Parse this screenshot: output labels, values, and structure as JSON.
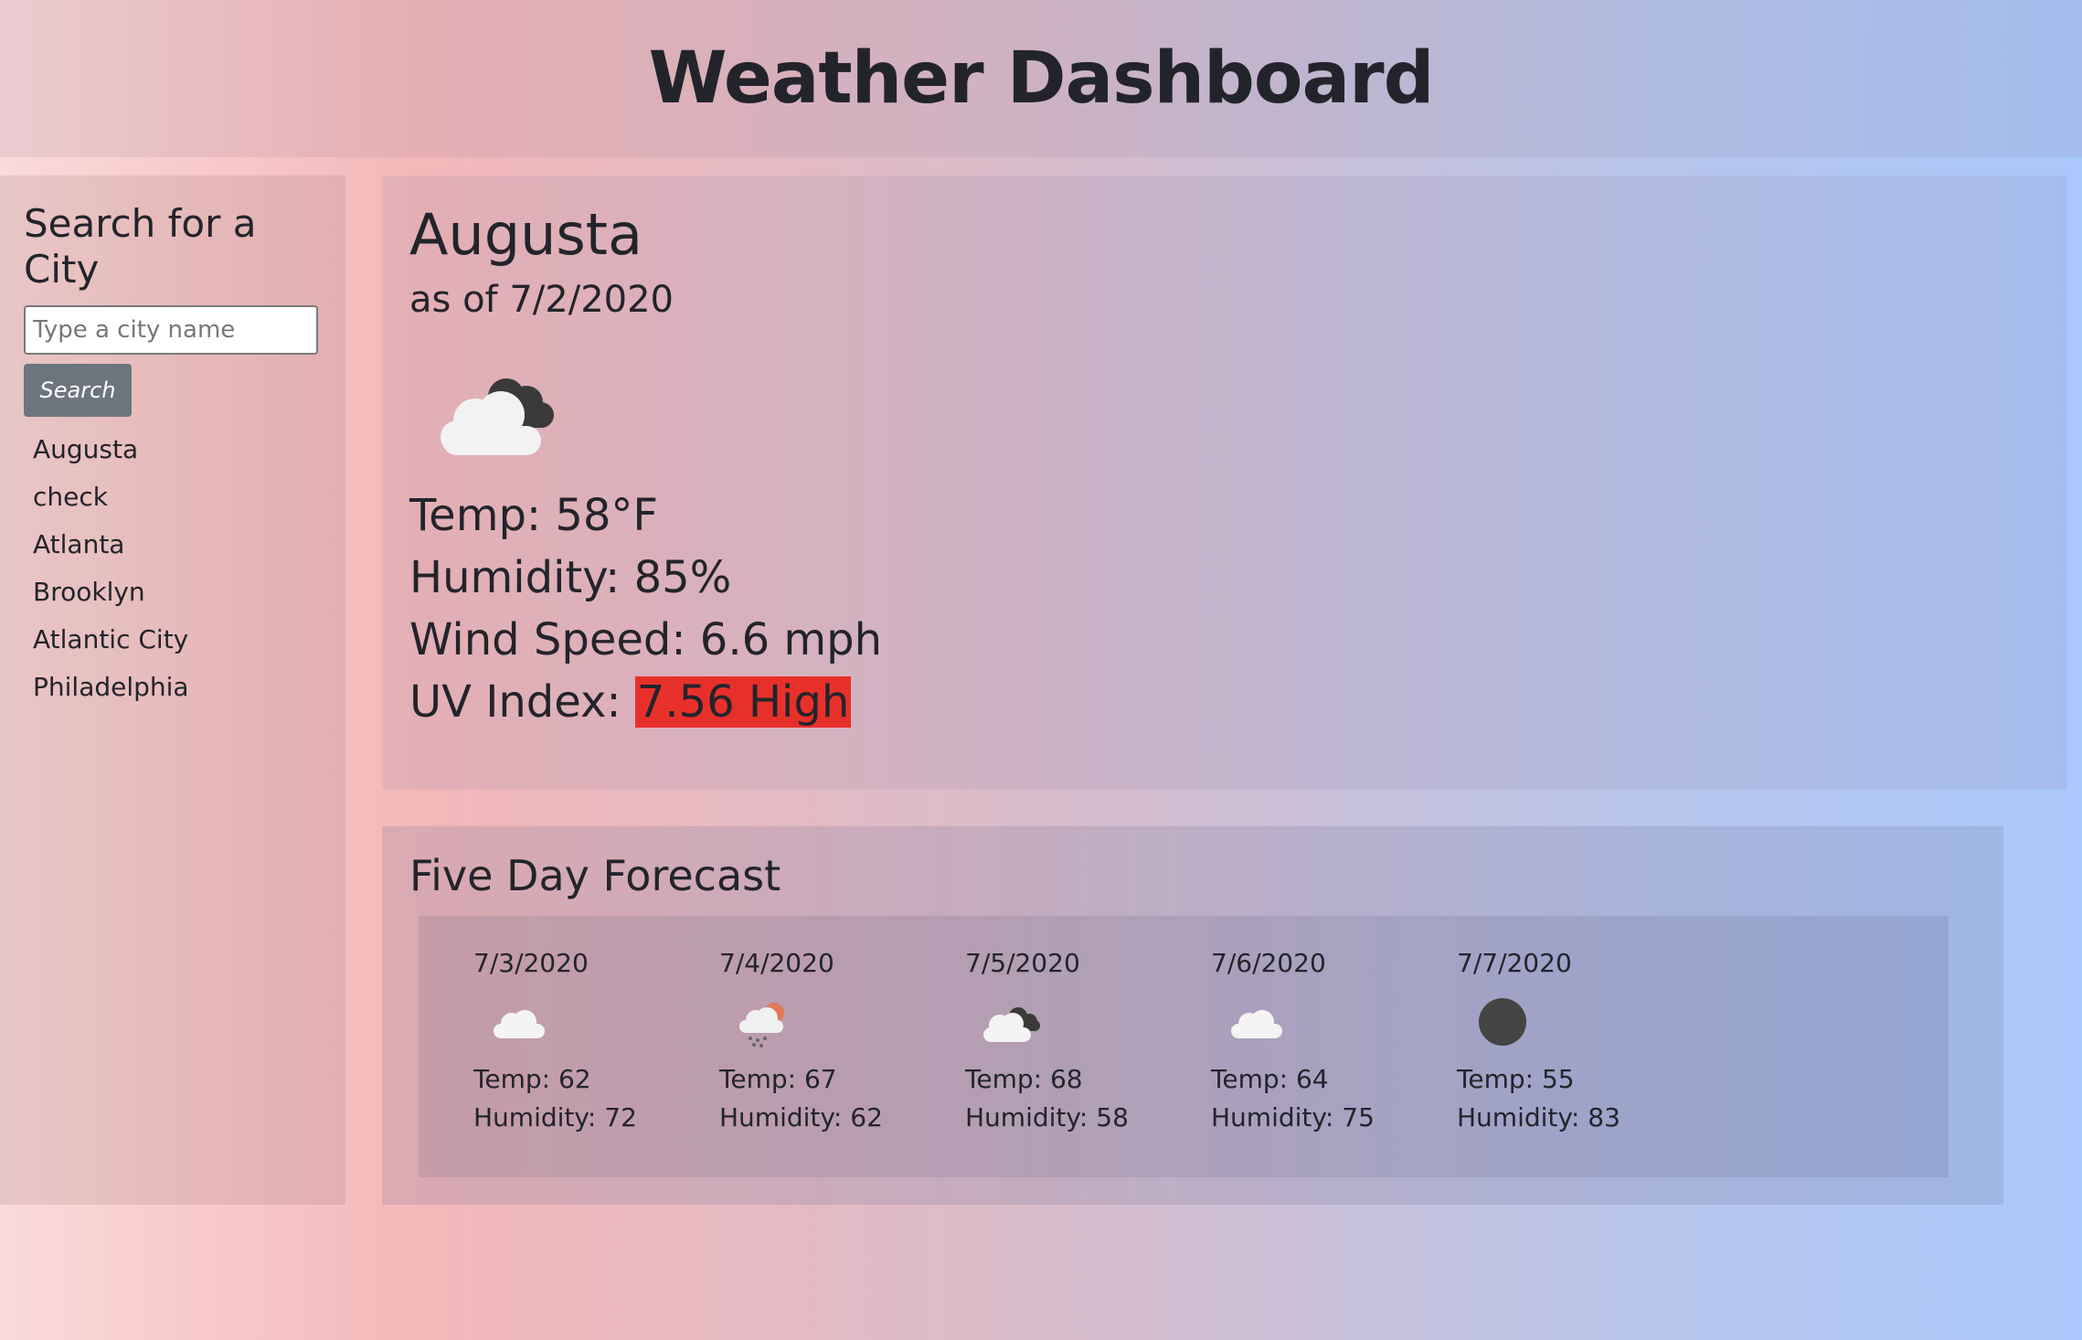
{
  "header": {
    "title": "Weather Dashboard"
  },
  "sidebar": {
    "heading": "Search for a City",
    "search": {
      "placeholder": "Type a city name",
      "value": ""
    },
    "search_button_label": "Search",
    "history": [
      "Augusta",
      "check",
      "Atlanta",
      "Brooklyn",
      "Atlantic City",
      "Philadelphia"
    ]
  },
  "current": {
    "city": "Augusta",
    "as_of": "as of 7/2/2020",
    "icon": "cloudy-icon",
    "temp": "Temp: 58°F",
    "humidity": "Humidity: 85%",
    "wind": "Wind Speed: 6.6 mph",
    "uv_label": "UV Index:",
    "uv_value": "7.56 High",
    "uv_color": "#e8302a"
  },
  "forecast": {
    "heading": "Five Day Forecast",
    "days": [
      {
        "date": "7/3/2020",
        "icon": "cloud-icon",
        "temp": "Temp: 62",
        "humidity": "Humidity: 72"
      },
      {
        "date": "7/4/2020",
        "icon": "rain-sun-icon",
        "temp": "Temp: 67",
        "humidity": "Humidity: 62"
      },
      {
        "date": "7/5/2020",
        "icon": "cloudy-icon",
        "temp": "Temp: 68",
        "humidity": "Humidity: 58"
      },
      {
        "date": "7/6/2020",
        "icon": "cloud-icon",
        "temp": "Temp: 64",
        "humidity": "Humidity: 75"
      },
      {
        "date": "7/7/2020",
        "icon": "dark-circle-icon",
        "temp": "Temp: 55",
        "humidity": "Humidity: 83"
      }
    ]
  }
}
